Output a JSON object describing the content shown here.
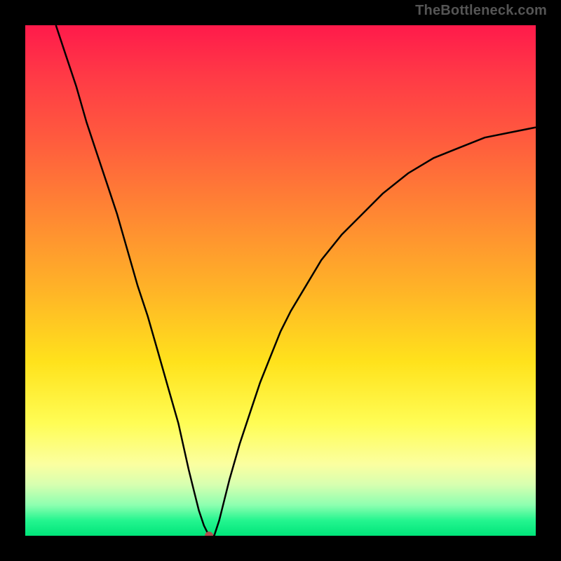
{
  "watermark": "TheBottleneck.com",
  "chart_data": {
    "type": "line",
    "title": "",
    "xlabel": "",
    "ylabel": "",
    "xlim": [
      0,
      100
    ],
    "ylim": [
      0,
      100
    ],
    "grid": false,
    "legend": false,
    "annotations": [],
    "minimum_point": {
      "x": 36,
      "y": 0
    },
    "series": [
      {
        "name": "curve",
        "x": [
          6,
          8,
          10,
          12,
          14,
          16,
          18,
          20,
          22,
          24,
          26,
          28,
          30,
          32,
          33,
          34,
          35,
          36,
          37,
          38,
          39,
          40,
          42,
          44,
          46,
          48,
          50,
          52,
          55,
          58,
          62,
          66,
          70,
          75,
          80,
          85,
          90,
          95,
          100
        ],
        "values": [
          100,
          94,
          88,
          81,
          75,
          69,
          63,
          56,
          49,
          43,
          36,
          29,
          22,
          13,
          9,
          5,
          2,
          0,
          0,
          3,
          7,
          11,
          18,
          24,
          30,
          35,
          40,
          44,
          49,
          54,
          59,
          63,
          67,
          71,
          74,
          76,
          78,
          79,
          80
        ]
      }
    ],
    "background_gradient": {
      "top": "#ff1a4b",
      "middle": "#ffe21c",
      "bottom": "#00e57a"
    }
  }
}
